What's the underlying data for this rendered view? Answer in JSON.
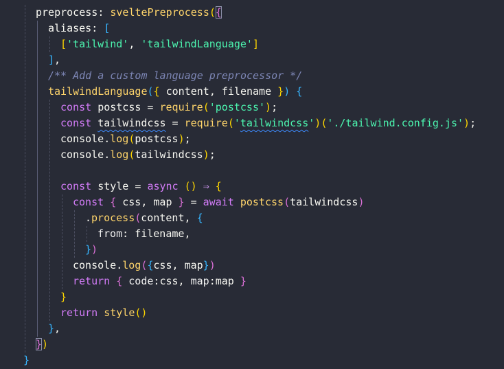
{
  "editor": {
    "language": "javascript",
    "theme_colors": {
      "background": "#282b36",
      "keyword": "#d37cf8",
      "function": "#ffd56b",
      "string": "#4cf6b0",
      "comment": "#7d86b5",
      "text": "#f8f8f2"
    },
    "lines": [
      {
        "indent": 1,
        "tokens": [
          {
            "t": "preprocess",
            "c": "p"
          },
          {
            "t": ": ",
            "c": "p"
          },
          {
            "t": "sveltePreprocess",
            "c": "f"
          },
          {
            "t": "(",
            "c": "br1"
          },
          {
            "t": "{",
            "c": "br2 match-box"
          }
        ]
      },
      {
        "indent": 2,
        "tokens": [
          {
            "t": "aliases",
            "c": "p"
          },
          {
            "t": ": ",
            "c": "p"
          },
          {
            "t": "[",
            "c": "br3"
          }
        ]
      },
      {
        "indent": 3,
        "tokens": [
          {
            "t": "[",
            "c": "br1"
          },
          {
            "t": "'tailwind'",
            "c": "s"
          },
          {
            "t": ", ",
            "c": "p"
          },
          {
            "t": "'tailwindLanguage'",
            "c": "s"
          },
          {
            "t": "]",
            "c": "br1"
          }
        ]
      },
      {
        "indent": 2,
        "tokens": [
          {
            "t": "]",
            "c": "br3"
          },
          {
            "t": ",",
            "c": "p"
          }
        ]
      },
      {
        "indent": 2,
        "tokens": [
          {
            "t": "/** Add a custom language preprocessor */",
            "c": "c"
          }
        ]
      },
      {
        "indent": 2,
        "tokens": [
          {
            "t": "tailwindLanguage",
            "c": "f"
          },
          {
            "t": "(",
            "c": "br3"
          },
          {
            "t": "{ ",
            "c": "br1"
          },
          {
            "t": "content",
            "c": "p"
          },
          {
            "t": ", ",
            "c": "p"
          },
          {
            "t": "filename",
            "c": "p"
          },
          {
            "t": " }",
            "c": "br1"
          },
          {
            "t": ")",
            "c": "br3"
          },
          {
            "t": " ",
            "c": "p"
          },
          {
            "t": "{",
            "c": "br3"
          }
        ]
      },
      {
        "indent": 3,
        "tokens": [
          {
            "t": "const ",
            "c": "k"
          },
          {
            "t": "postcss",
            "c": "p"
          },
          {
            "t": " = ",
            "c": "p"
          },
          {
            "t": "require",
            "c": "f"
          },
          {
            "t": "(",
            "c": "br1"
          },
          {
            "t": "'postcss'",
            "c": "s"
          },
          {
            "t": ")",
            "c": "br1"
          },
          {
            "t": ";",
            "c": "p"
          }
        ]
      },
      {
        "indent": 3,
        "tokens": [
          {
            "t": "const ",
            "c": "k"
          },
          {
            "t": "tailwindcss",
            "c": "p squig"
          },
          {
            "t": " = ",
            "c": "p"
          },
          {
            "t": "require",
            "c": "f"
          },
          {
            "t": "(",
            "c": "br1"
          },
          {
            "t": "'",
            "c": "s"
          },
          {
            "t": "tailwindcss",
            "c": "s squig"
          },
          {
            "t": "'",
            "c": "s"
          },
          {
            "t": ")",
            "c": "br1"
          },
          {
            "t": "(",
            "c": "br1"
          },
          {
            "t": "'./tailwind.config.js'",
            "c": "s"
          },
          {
            "t": ")",
            "c": "br1"
          },
          {
            "t": ";",
            "c": "p"
          }
        ]
      },
      {
        "indent": 3,
        "tokens": [
          {
            "t": "console",
            "c": "p"
          },
          {
            "t": ".",
            "c": "p"
          },
          {
            "t": "log",
            "c": "f"
          },
          {
            "t": "(",
            "c": "br1"
          },
          {
            "t": "postcss",
            "c": "p"
          },
          {
            "t": ")",
            "c": "br1"
          },
          {
            "t": ";",
            "c": "p"
          }
        ]
      },
      {
        "indent": 3,
        "tokens": [
          {
            "t": "console",
            "c": "p"
          },
          {
            "t": ".",
            "c": "p"
          },
          {
            "t": "log",
            "c": "f"
          },
          {
            "t": "(",
            "c": "br1"
          },
          {
            "t": "tailwindcss",
            "c": "p"
          },
          {
            "t": ")",
            "c": "br1"
          },
          {
            "t": ";",
            "c": "p"
          }
        ]
      },
      {
        "indent": 0,
        "tokens": []
      },
      {
        "indent": 3,
        "tokens": [
          {
            "t": "const ",
            "c": "k"
          },
          {
            "t": "style",
            "c": "p"
          },
          {
            "t": " = ",
            "c": "p"
          },
          {
            "t": "async ",
            "c": "k"
          },
          {
            "t": "()",
            "c": "br1"
          },
          {
            "t": " ⇒ ",
            "c": "op"
          },
          {
            "t": "{",
            "c": "br1"
          }
        ]
      },
      {
        "indent": 4,
        "tokens": [
          {
            "t": "const ",
            "c": "k"
          },
          {
            "t": "{ ",
            "c": "br2"
          },
          {
            "t": "css",
            "c": "p"
          },
          {
            "t": ", ",
            "c": "p"
          },
          {
            "t": "map",
            "c": "p"
          },
          {
            "t": " }",
            "c": "br2"
          },
          {
            "t": " = ",
            "c": "p"
          },
          {
            "t": "await ",
            "c": "k"
          },
          {
            "t": "postcss",
            "c": "f"
          },
          {
            "t": "(",
            "c": "br2"
          },
          {
            "t": "tailwindcss",
            "c": "p"
          },
          {
            "t": ")",
            "c": "br2"
          }
        ]
      },
      {
        "indent": 5,
        "tokens": [
          {
            "t": ".",
            "c": "p"
          },
          {
            "t": "process",
            "c": "f"
          },
          {
            "t": "(",
            "c": "br2"
          },
          {
            "t": "content",
            "c": "p"
          },
          {
            "t": ", ",
            "c": "p"
          },
          {
            "t": "{",
            "c": "br3"
          }
        ]
      },
      {
        "indent": 6,
        "tokens": [
          {
            "t": "from",
            "c": "pr"
          },
          {
            "t": ": ",
            "c": "p"
          },
          {
            "t": "filename",
            "c": "p"
          },
          {
            "t": ",",
            "c": "p"
          }
        ]
      },
      {
        "indent": 5,
        "tokens": [
          {
            "t": "}",
            "c": "br3"
          },
          {
            "t": ")",
            "c": "br2"
          }
        ]
      },
      {
        "indent": 4,
        "tokens": [
          {
            "t": "console",
            "c": "p"
          },
          {
            "t": ".",
            "c": "p"
          },
          {
            "t": "log",
            "c": "f"
          },
          {
            "t": "(",
            "c": "br2"
          },
          {
            "t": "{",
            "c": "br3"
          },
          {
            "t": "css",
            "c": "p"
          },
          {
            "t": ", ",
            "c": "p"
          },
          {
            "t": "map",
            "c": "p"
          },
          {
            "t": "}",
            "c": "br3"
          },
          {
            "t": ")",
            "c": "br2"
          }
        ]
      },
      {
        "indent": 4,
        "tokens": [
          {
            "t": "return ",
            "c": "k"
          },
          {
            "t": "{ ",
            "c": "br2"
          },
          {
            "t": "code",
            "c": "pr"
          },
          {
            "t": ":",
            "c": "p"
          },
          {
            "t": "css",
            "c": "p"
          },
          {
            "t": ", ",
            "c": "p"
          },
          {
            "t": "map",
            "c": "pr"
          },
          {
            "t": ":",
            "c": "p"
          },
          {
            "t": "map",
            "c": "p"
          },
          {
            "t": " }",
            "c": "br2"
          }
        ]
      },
      {
        "indent": 3,
        "tokens": [
          {
            "t": "}",
            "c": "br1"
          }
        ]
      },
      {
        "indent": 3,
        "tokens": [
          {
            "t": "return ",
            "c": "k"
          },
          {
            "t": "style",
            "c": "f"
          },
          {
            "t": "()",
            "c": "br1"
          }
        ]
      },
      {
        "indent": 2,
        "tokens": [
          {
            "t": "}",
            "c": "br3"
          },
          {
            "t": ",",
            "c": "p"
          }
        ]
      },
      {
        "indent": 1,
        "tokens": [
          {
            "t": "}",
            "c": "br2 match-box"
          },
          {
            "t": ")",
            "c": "br1"
          }
        ]
      },
      {
        "indent": 0,
        "tokens": [
          {
            "t": "}",
            "c": "br3"
          }
        ]
      }
    ]
  }
}
